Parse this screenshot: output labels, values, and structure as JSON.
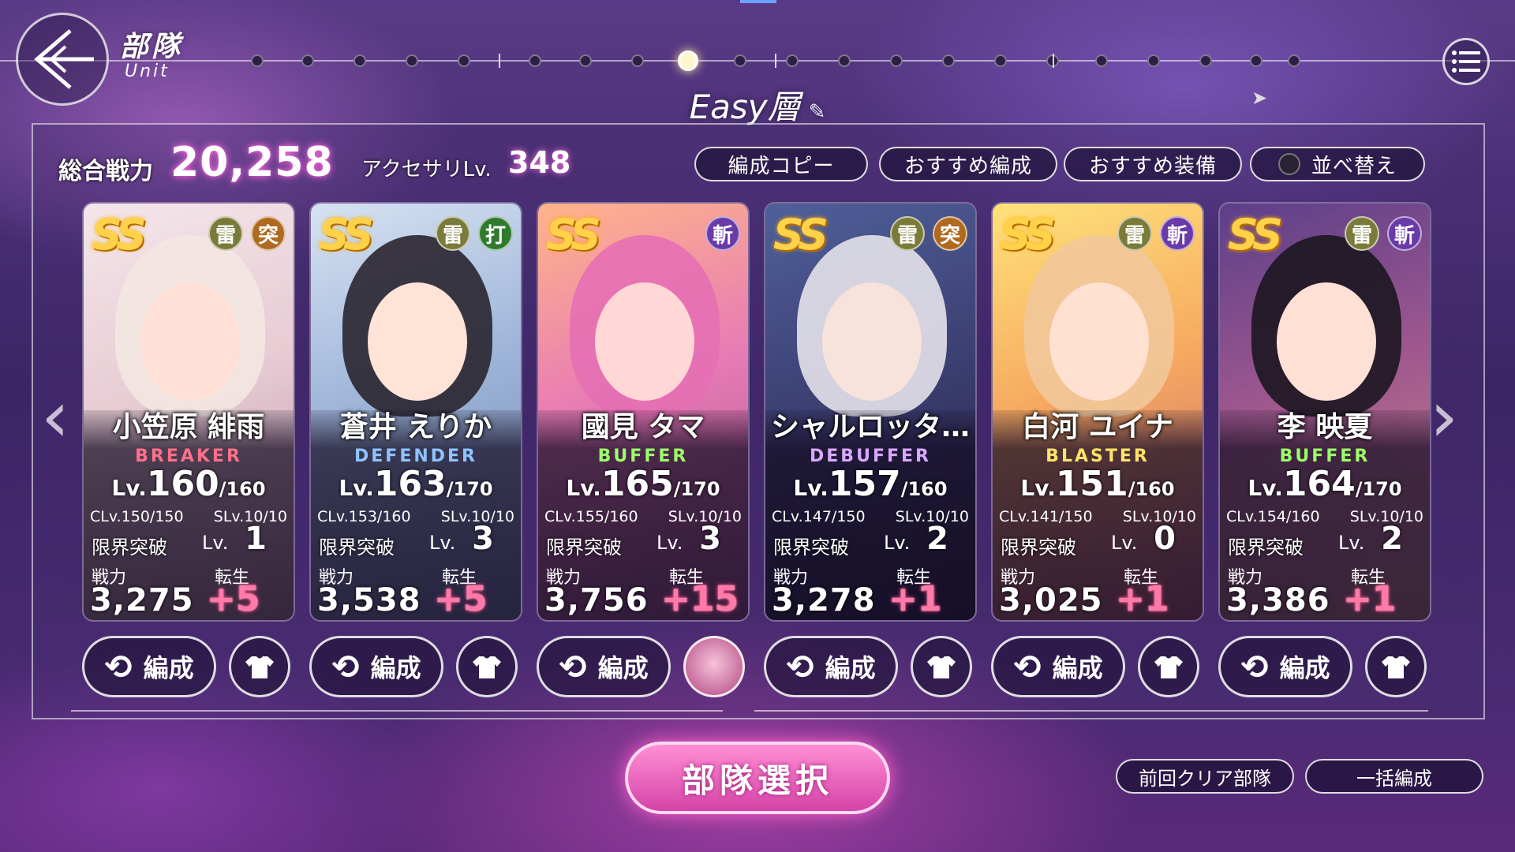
{
  "header": {
    "title_jp": "部隊",
    "title_en": "Unit",
    "stage_label": "Easy層",
    "edit_icon": "pencil-icon",
    "back_icon": "back-arrow-icon",
    "menu_icon": "list-menu-icon"
  },
  "summary": {
    "total_power_label": "総合戦力",
    "total_power": "20,258",
    "accessory_label": "アクセサリLv.",
    "accessory_level": "348"
  },
  "toolbar": {
    "copy_label": "編成コピー",
    "recommend_team_label": "おすすめ編成",
    "recommend_equip_label": "おすすめ装備",
    "sort_label": "並べ替え"
  },
  "card_labels": {
    "limit_break": "限界突破",
    "lv_prefix": "Lv.",
    "power": "戦力",
    "rebirth": "転生",
    "rank": "SS"
  },
  "units": [
    {
      "name": "小笠原 緋雨",
      "role": "BREAKER",
      "role_color": "#ff6f8a",
      "level": "160",
      "max_level": "/160",
      "clv": "CLv.150/150",
      "slv": "SLv.10/10",
      "limit_lv": "1",
      "power": "3,275",
      "rebirth": "+5",
      "tags": [
        "雷",
        "突"
      ]
    },
    {
      "name": "蒼井 えりか",
      "role": "DEFENDER",
      "role_color": "#8fc3ff",
      "level": "163",
      "max_level": "/170",
      "clv": "CLv.153/160",
      "slv": "SLv.10/10",
      "limit_lv": "3",
      "power": "3,538",
      "rebirth": "+5",
      "tags": [
        "雷",
        "打"
      ]
    },
    {
      "name": "國見 タマ",
      "role": "BUFFER",
      "role_color": "#9dff6a",
      "level": "165",
      "max_level": "/170",
      "clv": "CLv.155/160",
      "slv": "SLv.10/10",
      "limit_lv": "3",
      "power": "3,756",
      "rebirth": "+15",
      "tags": [
        "斬"
      ]
    },
    {
      "name": "シャルロッタ…",
      "role": "DEBUFFER",
      "role_color": "#d9a8ff",
      "level": "157",
      "max_level": "/160",
      "clv": "CLv.147/150",
      "slv": "SLv.10/10",
      "limit_lv": "2",
      "power": "3,278",
      "rebirth": "+1",
      "tags": [
        "雷",
        "突"
      ]
    },
    {
      "name": "白河 ユイナ",
      "role": "BLASTER",
      "role_color": "#ffe36a",
      "level": "151",
      "max_level": "/160",
      "clv": "CLv.141/150",
      "slv": "SLv.10/10",
      "limit_lv": "0",
      "power": "3,025",
      "rebirth": "+1",
      "tags": [
        "雷",
        "斬"
      ]
    },
    {
      "name": "李 映夏",
      "role": "BUFFER",
      "role_color": "#9dff6a",
      "level": "164",
      "max_level": "/170",
      "clv": "CLv.154/160",
      "slv": "SLv.10/10",
      "limit_lv": "2",
      "power": "3,386",
      "rebirth": "+1",
      "tags": [
        "雷",
        "斬"
      ]
    }
  ],
  "actions": {
    "edit_label": "編成",
    "select_team_label": "部隊選択",
    "last_clear_label": "前回クリア部隊",
    "bulk_label": "一括編成"
  },
  "colors": {
    "tag_thunder": "#7a7a3a",
    "tag_pierce": "#b06a20",
    "tag_blunt": "#2f7a2f",
    "tag_slash": "#6a3aa8",
    "accent_pink": "#ff6fe1",
    "rank_gold": "#ffd24a"
  }
}
